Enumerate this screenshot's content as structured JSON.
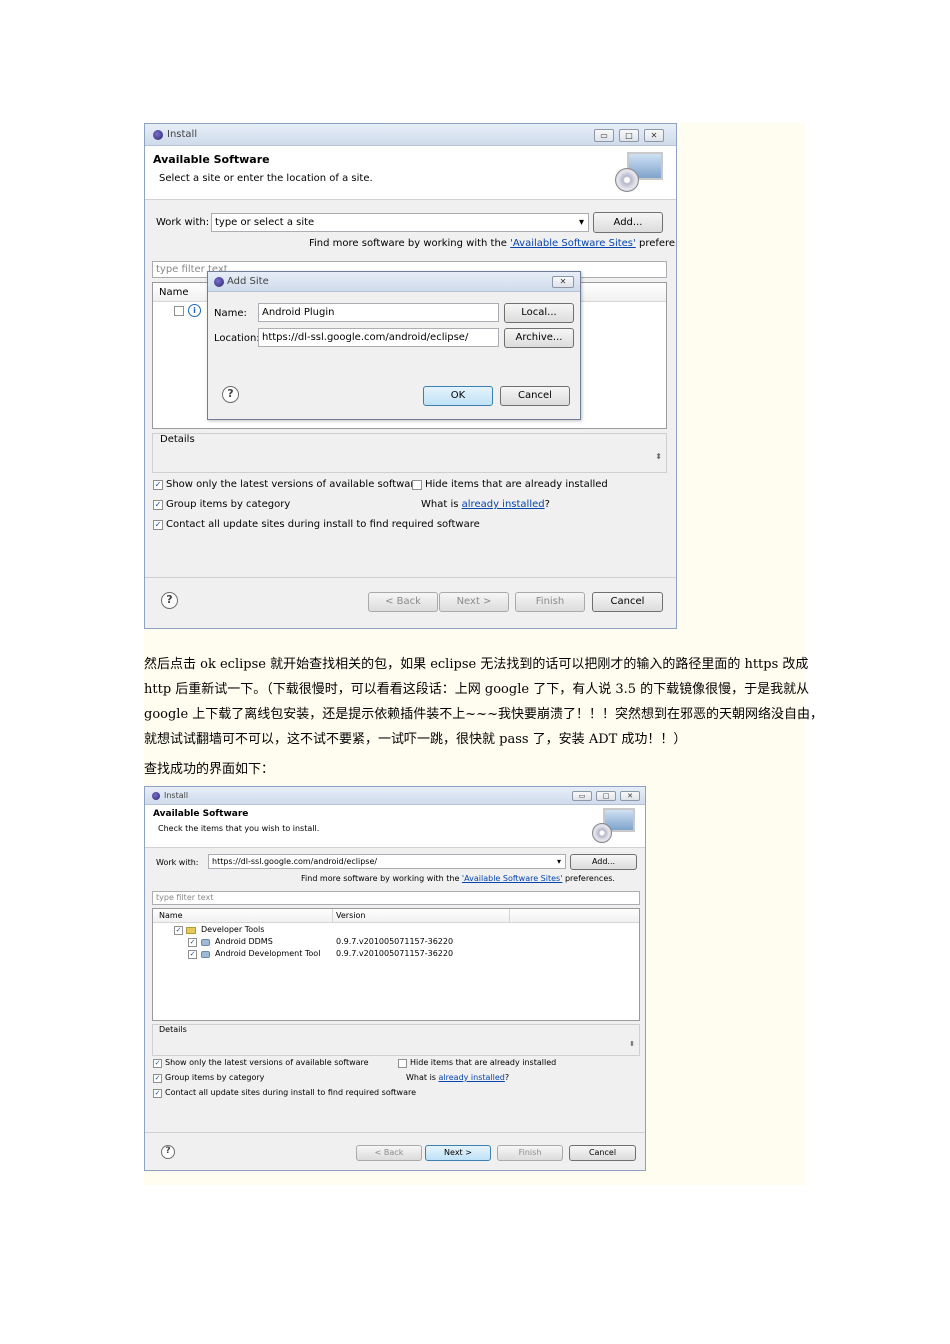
{
  "shot1": {
    "window_title": "Install",
    "header_title": "Available Software",
    "header_subtitle": "Select a site or enter the location of a site.",
    "work_with_label": "Work with:",
    "work_with_value": "type or select a site",
    "add_button": "Add...",
    "find_more_prefix": "Find more software by working with the",
    "find_more_link": "'Available Software Sites'",
    "find_more_suffix": "preferences.",
    "filter_placeholder": "type filter text",
    "col_name": "Name",
    "details_label": "Details",
    "cb_latest": "Show only the latest versions of available software",
    "cb_hide_installed": "Hide items that are already installed",
    "cb_group": "Group items by category",
    "what_is_prefix": "What is",
    "what_is_link": "already installed",
    "what_is_suffix": "?",
    "cb_contact": "Contact all update sites during install to find required software",
    "back_button": "< Back",
    "next_button": "Next >",
    "finish_button": "Finish",
    "cancel_button": "Cancel",
    "add_site": {
      "title": "Add Site",
      "name_label": "Name:",
      "name_value": "Android Plugin",
      "location_label": "Location:",
      "location_value": "https://dl-ssl.google.com/android/eclipse/",
      "local_button": "Local...",
      "archive_button": "Archive...",
      "ok_button": "OK",
      "cancel_button": "Cancel"
    }
  },
  "paragraph_lines": [
    "然后点击 ok eclipse 就开始查找相关的包，如果 eclipse 无法找到的话可以把刚才的输入的路径里面的 https 改成",
    "http 后重新试一下。（下载很慢时，可以看看这段话：上网 google 了下，有人说 3.5 的下载镜像很慢，于是我就从",
    "google 上下载了离线包安装，还是提示依赖插件装不上~~~我快要崩溃了！！！突然想到在邪恶的天朝网络没自由，",
    "就想试试翻墙可不可以，这不试不要紧，一试吓一跳，很快就 pass 了，安装 ADT 成功！！）",
    "查找成功的界面如下："
  ],
  "shot2": {
    "window_title": "Install",
    "header_title": "Available Software",
    "header_subtitle": "Check the items that you wish to install.",
    "work_with_label": "Work with:",
    "work_with_value": "https://dl-ssl.google.com/android/eclipse/",
    "add_button": "Add...",
    "find_more_prefix": "Find more software by working with the",
    "find_more_link": "'Available Software Sites'",
    "find_more_suffix": "preferences.",
    "filter_placeholder": "type filter text",
    "col_name": "Name",
    "col_version": "Version",
    "tree_items": [
      {
        "label": "Developer Tools",
        "version": ""
      },
      {
        "label": "Android DDMS",
        "version": "0.9.7.v201005071157-36220"
      },
      {
        "label": "Android Development Tool",
        "version": "0.9.7.v201005071157-36220"
      }
    ],
    "details_label": "Details",
    "cb_latest": "Show only the latest versions of available software",
    "cb_hide_installed": "Hide items that are already installed",
    "cb_group": "Group items by category",
    "what_is_prefix": "What is",
    "what_is_link": "already installed",
    "what_is_suffix": "?",
    "cb_contact": "Contact all update sites during install to find required software",
    "back_button": "< Back",
    "next_button": "Next >",
    "finish_button": "Finish",
    "cancel_button": "Cancel"
  }
}
